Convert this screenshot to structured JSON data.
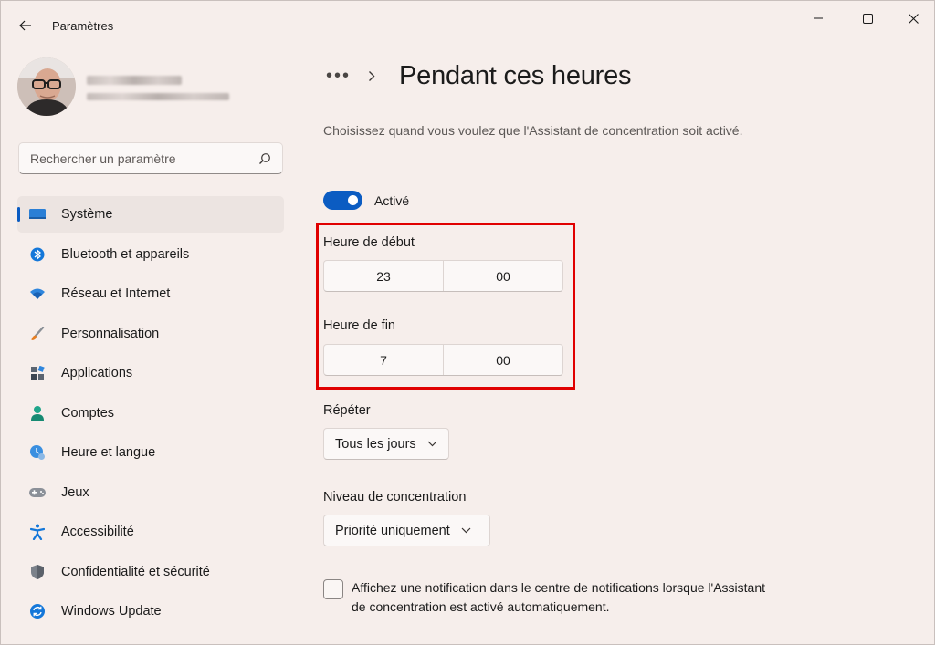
{
  "window": {
    "app_title": "Paramètres"
  },
  "search": {
    "placeholder": "Rechercher un paramètre"
  },
  "sidebar": {
    "items": [
      {
        "label": "Système",
        "icon": "monitor-icon",
        "active": true
      },
      {
        "label": "Bluetooth et appareils",
        "icon": "bluetooth-icon"
      },
      {
        "label": "Réseau et Internet",
        "icon": "wifi-icon"
      },
      {
        "label": "Personnalisation",
        "icon": "brush-icon"
      },
      {
        "label": "Applications",
        "icon": "apps-icon"
      },
      {
        "label": "Comptes",
        "icon": "person-icon"
      },
      {
        "label": "Heure et langue",
        "icon": "clock-globe-icon"
      },
      {
        "label": "Jeux",
        "icon": "gamepad-icon"
      },
      {
        "label": "Accessibilité",
        "icon": "accessibility-icon"
      },
      {
        "label": "Confidentialité et sécurité",
        "icon": "shield-icon"
      },
      {
        "label": "Windows Update",
        "icon": "update-icon"
      }
    ]
  },
  "main": {
    "breadcrumb_more": "•••",
    "title": "Pendant ces heures",
    "description": "Choisissez quand vous voulez que l'Assistant de concentration soit activé.",
    "toggle": {
      "label": "Activé",
      "on": true
    },
    "start": {
      "label": "Heure de début",
      "hour": "23",
      "minute": "00"
    },
    "end": {
      "label": "Heure de fin",
      "hour": "7",
      "minute": "00"
    },
    "repeat": {
      "label": "Répéter",
      "value": "Tous les jours"
    },
    "focus_level": {
      "label": "Niveau de concentration",
      "value": "Priorité uniquement"
    },
    "notification_checkbox": {
      "label": "Affichez une notification dans le centre de notifications lorsque l'Assistant de concentration est activé automatiquement.",
      "checked": false
    }
  },
  "colors": {
    "accent": "#0b5cc2",
    "highlight": "#e00000"
  }
}
